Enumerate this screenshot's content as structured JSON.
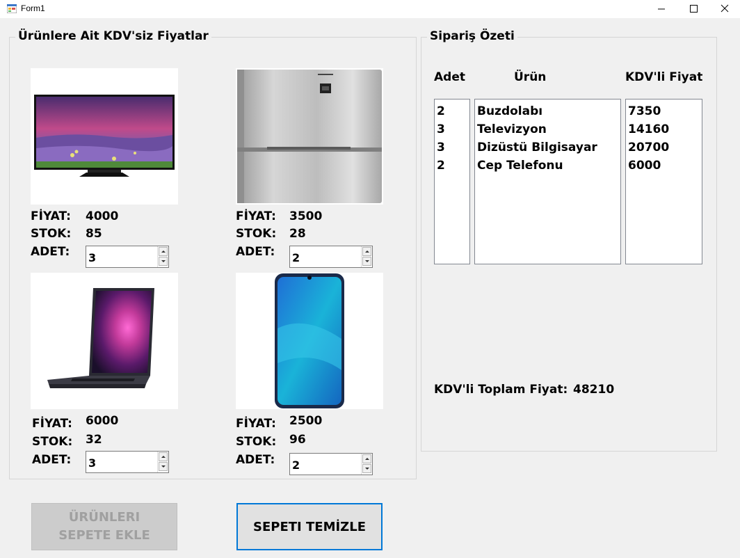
{
  "window": {
    "title": "Form1"
  },
  "products_group": {
    "title": "Ürünlere Ait KDV'siz Fiyatlar",
    "products": [
      {
        "name": "Televizyon",
        "image": "tv-image",
        "price_label": "FİYAT:",
        "price": "4000",
        "stock_label": "STOK:",
        "stock": "85",
        "qty_label": "ADET:",
        "qty": "3"
      },
      {
        "name": "Buzdolabı",
        "image": "fridge-image",
        "price_label": "FİYAT:",
        "price": "3500",
        "stock_label": "STOK:",
        "stock": "28",
        "qty_label": "ADET:",
        "qty": "2"
      },
      {
        "name": "Dizüstü Bilgisayar",
        "image": "laptop-image",
        "price_label": "FİYAT:",
        "price": "6000",
        "stock_label": "STOK:",
        "stock": "32",
        "qty_label": "ADET:",
        "qty": "3"
      },
      {
        "name": "Cep Telefonu",
        "image": "phone-image",
        "price_label": "FİYAT:",
        "price": "2500",
        "stock_label": "STOK:",
        "stock": "96",
        "qty_label": "ADET:",
        "qty": "2"
      }
    ]
  },
  "summary_group": {
    "title": "Sipariş Özeti",
    "headers": {
      "qty": "Adet",
      "product": "Ürün",
      "price": "KDV'li Fiyat"
    },
    "qty_list": [
      "2",
      "3",
      "3",
      "2"
    ],
    "product_list": [
      "Buzdolabı",
      "Televizyon",
      "Dizüstü Bilgisayar",
      "Cep Telefonu"
    ],
    "price_list": [
      "7350",
      "14160",
      "20700",
      "6000"
    ],
    "total_label": "KDV'li Toplam Fiyat:",
    "total_value": "48210"
  },
  "buttons": {
    "add_to_cart": "ÜRÜNLERI SEPETE EKLE",
    "clear_cart": "SEPETI TEMİZLE"
  },
  "colors": {
    "accent": "#0078d7",
    "window_bg": "#f0f0f0",
    "disabled_text": "#a0a0a0"
  }
}
